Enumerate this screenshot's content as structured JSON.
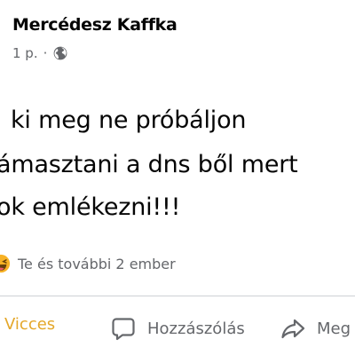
{
  "post": {
    "author": "Mercédesz Kaffka",
    "time": "1 p.",
    "separator": "·",
    "privacy_icon": "globe-icon",
    "text_lines": [
      "ki meg ne próbáljon",
      "ámasztani a dns ből mert",
      "ok emlékezni!!!"
    ]
  },
  "reactions": {
    "icon": "haha-emoji-icon",
    "summary": "Te és további 2 ember"
  },
  "actions": {
    "react_label": "Vicces",
    "comment_label": "Hozzászólás",
    "share_label": "Meg"
  },
  "colors": {
    "text": "#050505",
    "secondary": "#65676b",
    "reaction_active": "#e4a72a",
    "divider": "#ced0d4"
  }
}
